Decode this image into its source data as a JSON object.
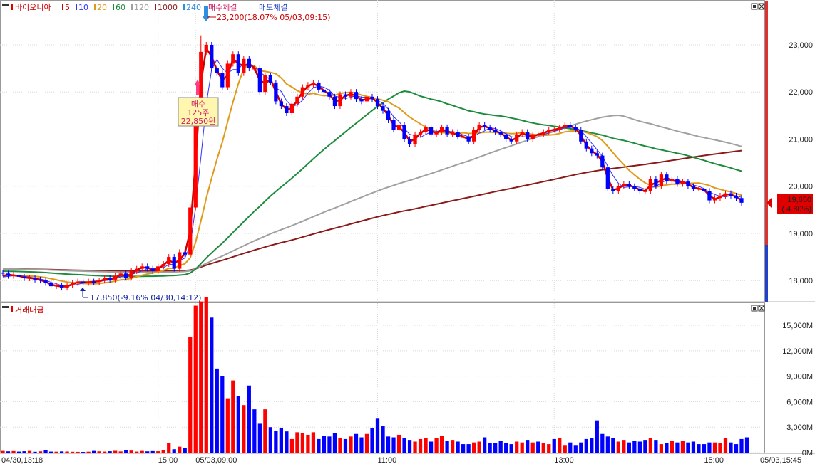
{
  "colors": {
    "up": "#ff0000",
    "down": "#0000ff",
    "ma5": "#cc0000",
    "ma10": "#3030ff",
    "ma20": "#e09a1a",
    "ma60": "#1c8c3c",
    "ma120": "#a0a0a0",
    "ma1000": "#8b1a1a",
    "grid": "#d8d8d8"
  },
  "price_panel": {
    "title": "바이오니아",
    "legend": [
      "5",
      "10",
      "20",
      "60",
      "120",
      "1000",
      "240"
    ],
    "signals": {
      "buy": "매수체결",
      "sell": "매도체결"
    },
    "buy_marker": {
      "line1": "매수",
      "line2": "125주",
      "line3": "22,850원"
    },
    "high_annotation": "23,200(18.07% 05/03,09:15)",
    "low_annotation": "17,850(-9.16% 04/30,14:12)",
    "last_price": "19,650",
    "last_change": "( 4.80%)"
  },
  "volume_panel": {
    "title": "거래대금"
  },
  "x_axis_labels": [
    "04/30,13:18",
    "15:00",
    "05/03,09:00",
    "11:00",
    "13:00",
    "15:00",
    "05/03,15:45"
  ],
  "chart_data": [
    {
      "type": "candlestick",
      "title": "바이오니아",
      "y_ticks": [
        18000,
        19000,
        20000,
        21000,
        22000,
        23000
      ],
      "y_tick_labels": [
        "18,000",
        "19,000",
        "20,000",
        "21,000",
        "22,000",
        "23,000"
      ],
      "ylim": [
        17550,
        23950
      ],
      "x_labels": [
        "04/30,13:18",
        "15:00",
        "05/03,09:00",
        "11:00",
        "13:00",
        "15:00",
        "05/03,15:45"
      ],
      "close": [
        18150,
        18100,
        18120,
        18080,
        18050,
        18060,
        18020,
        18000,
        17950,
        17880,
        17900,
        17850,
        17900,
        17950,
        17980,
        17950,
        17980,
        17970,
        18000,
        18050,
        18020,
        18100,
        18150,
        18060,
        18200,
        18250,
        18300,
        18250,
        18200,
        18300,
        18350,
        18500,
        18250,
        18600,
        18550,
        19550,
        21550,
        22850,
        23000,
        22500,
        22400,
        22100,
        22600,
        22800,
        22400,
        22700,
        22500,
        22500,
        22000,
        22350,
        22200,
        21800,
        21700,
        21550,
        21750,
        21900,
        22100,
        22150,
        22200,
        22050,
        22000,
        21900,
        21700,
        21950,
        21900,
        22000,
        21850,
        21800,
        21900,
        21850,
        21700,
        21600,
        21400,
        21200,
        21300,
        21000,
        20900,
        21100,
        21150,
        21250,
        21100,
        21150,
        21250,
        21100,
        21150,
        21050,
        21050,
        20950,
        21200,
        21300,
        21250,
        21200,
        21150,
        21100,
        21000,
        20950,
        21100,
        21150,
        21000,
        21100,
        21100,
        21150,
        21200,
        21200,
        21250,
        21300,
        21250,
        21200,
        20950,
        20800,
        20700,
        20650,
        20400,
        19950,
        19900,
        20000,
        20050,
        20000,
        19950,
        19900,
        19900,
        20150,
        20000,
        20250,
        20100,
        20150,
        20050,
        20100,
        20000,
        19950,
        19950,
        19900,
        19700,
        19750,
        19800,
        19850,
        19800,
        19750,
        19650
      ]
    },
    {
      "type": "bar",
      "title": "거래대금",
      "y_ticks": [
        0,
        3000,
        6000,
        9000,
        12000,
        15000
      ],
      "y_tick_labels": [
        "0M",
        "3,000M",
        "6,000M",
        "9,000M",
        "12,000M",
        "15,000M"
      ],
      "ylim": [
        0,
        17600
      ],
      "values": [
        200,
        150,
        180,
        120,
        160,
        200,
        100,
        150,
        300,
        120,
        110,
        140,
        130,
        100,
        90,
        80,
        110,
        200,
        150,
        120,
        160,
        210,
        140,
        300,
        240,
        120,
        200,
        150,
        180,
        160,
        250,
        1100,
        400,
        700,
        550,
        13600,
        17300,
        17800,
        18300,
        15900,
        9900,
        9000,
        6400,
        8500,
        6700,
        5600,
        7900,
        5100,
        3400,
        5100,
        3000,
        2600,
        2900,
        2500,
        1600,
        2400,
        2300,
        2100,
        2400,
        1600,
        2000,
        1900,
        2300,
        1700,
        1600,
        1900,
        2200,
        1800,
        2200,
        2900,
        4000,
        3100,
        1900,
        1800,
        2100,
        1700,
        1500,
        1300,
        1600,
        1700,
        1300,
        1700,
        2000,
        1400,
        1500,
        1300,
        1000,
        1000,
        1200,
        1300,
        1800,
        1100,
        1100,
        1400,
        1100,
        1000,
        1300,
        1200,
        1500,
        1200,
        1300,
        1100,
        1000,
        1600,
        1700,
        900,
        1200,
        900,
        1200,
        1600,
        1700,
        3800,
        2200,
        1900,
        1700,
        1300,
        1500,
        1200,
        1400,
        1300,
        1500,
        1700,
        1500,
        1000,
        1100,
        1400,
        1200,
        1400,
        1200,
        1300,
        1000,
        1000,
        1200,
        1200,
        1100,
        1700,
        1200,
        1000,
        1600,
        1800
      ],
      "colors_up": [
        1,
        0,
        1,
        0,
        0,
        1,
        0,
        1,
        0,
        0,
        1,
        0,
        1,
        1,
        1,
        0,
        1,
        0,
        1,
        1,
        0,
        1,
        1,
        0,
        1,
        1,
        1,
        0,
        0,
        1,
        1,
        1,
        0,
        1,
        0,
        1,
        1,
        1,
        1,
        0,
        0,
        0,
        1,
        1,
        0,
        1,
        0,
        0,
        0,
        1,
        0,
        0,
        0,
        0,
        1,
        1,
        1,
        1,
        1,
        0,
        0,
        0,
        0,
        1,
        0,
        1,
        0,
        0,
        1,
        0,
        0,
        0,
        0,
        0,
        1,
        0,
        0,
        1,
        1,
        1,
        0,
        1,
        1,
        0,
        1,
        0,
        0,
        0,
        1,
        1,
        0,
        0,
        0,
        0,
        0,
        0,
        1,
        1,
        0,
        1,
        0,
        1,
        1,
        0,
        1,
        1,
        0,
        0,
        0,
        0,
        0,
        0,
        0,
        0,
        0,
        1,
        1,
        0,
        0,
        0,
        0,
        1,
        0,
        1,
        0,
        1,
        0,
        1,
        0,
        0,
        0,
        0,
        0,
        1,
        1,
        1,
        0,
        0,
        0
      ]
    }
  ]
}
